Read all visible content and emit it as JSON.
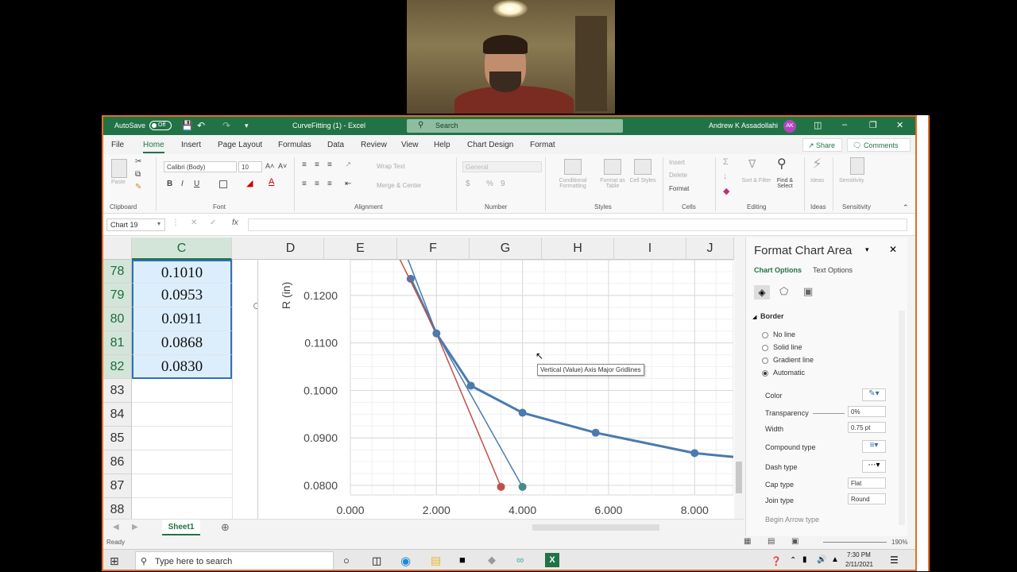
{
  "title_bar": {
    "autosave_label": "AutoSave",
    "autosave_state": "Off",
    "document_title": "CurveFitting (1) - Excel",
    "search_placeholder": "Search",
    "user_name": "Andrew K Assadollahi",
    "user_initials": "AK"
  },
  "ribbon_tabs": [
    "File",
    "Home",
    "Insert",
    "Page Layout",
    "Formulas",
    "Data",
    "Review",
    "View",
    "Help",
    "Chart Design",
    "Format"
  ],
  "ribbon_actions": {
    "share": "Share",
    "comments": "Comments"
  },
  "ribbon": {
    "clipboard": {
      "paste": "Paste",
      "label": "Clipboard"
    },
    "font": {
      "name": "Calibri (Body)",
      "size": "10",
      "label": "Font",
      "bold": "B",
      "italic": "I",
      "underline": "U"
    },
    "alignment": {
      "wrap": "Wrap Text",
      "merge": "Merge & Center",
      "label": "Alignment"
    },
    "number": {
      "format": "General",
      "label": "Number"
    },
    "styles": {
      "conditional": "Conditional Formatting",
      "format_table": "Format as Table",
      "cell_styles": "Cell Styles",
      "label": "Styles"
    },
    "cells": {
      "insert": "Insert",
      "delete": "Delete",
      "format": "Format",
      "label": "Cells"
    },
    "editing": {
      "sort": "Sort & Filter",
      "find": "Find & Select",
      "label": "Editing"
    },
    "ideas": {
      "ideas": "Ideas",
      "label": "Ideas"
    },
    "sensitivity": {
      "sensitivity": "Sensitivity",
      "label": "Sensitivity"
    }
  },
  "formula_bar": {
    "name_box": "Chart 19",
    "fx": "fx"
  },
  "columns": [
    "C",
    "D",
    "E",
    "F",
    "G",
    "H",
    "I",
    "J"
  ],
  "rows": [
    {
      "num": "78",
      "c": "0.1010"
    },
    {
      "num": "79",
      "c": "0.0953"
    },
    {
      "num": "80",
      "c": "0.0911"
    },
    {
      "num": "81",
      "c": "0.0868"
    },
    {
      "num": "82",
      "c": "0.0830"
    },
    {
      "num": "83",
      "c": ""
    },
    {
      "num": "84",
      "c": ""
    },
    {
      "num": "85",
      "c": ""
    },
    {
      "num": "86",
      "c": ""
    },
    {
      "num": "87",
      "c": ""
    },
    {
      "num": "88",
      "c": ""
    }
  ],
  "chart_data": {
    "type": "scatter",
    "title": "",
    "ylabel": "R (in)",
    "xlabel": "",
    "xlim": [
      0,
      8.9
    ],
    "ylim": [
      0.078,
      0.1275
    ],
    "x_ticks": [
      "0.000",
      "2.000",
      "4.000",
      "6.000",
      "8.000"
    ],
    "y_ticks": [
      "0.1200",
      "0.1100",
      "0.1000",
      "0.0900",
      "0.0800"
    ],
    "grid": true,
    "series": [
      {
        "color": "#4a7ab0",
        "marker": true,
        "x": [
          1.4,
          2.0,
          2.8,
          4.0,
          5.7,
          8.0,
          8.9
        ],
        "y": [
          0.1235,
          0.112,
          0.101,
          0.0953,
          0.0911,
          0.0868,
          0.086
        ]
      },
      {
        "color": "#c0504d",
        "marker": false,
        "x": [
          1.1,
          2.0,
          3.5
        ],
        "y": [
          0.1285,
          0.112,
          0.0797
        ]
      },
      {
        "color": "#4a7ab0",
        "marker": false,
        "x": [
          1.3,
          2.0,
          4.0
        ],
        "y": [
          0.1285,
          0.112,
          0.0797
        ]
      }
    ],
    "highlight_points": [
      {
        "x": 3.5,
        "y": 0.0797,
        "color": "#c0504d"
      },
      {
        "x": 4.0,
        "y": 0.0797,
        "color": "#4a8a8c"
      }
    ]
  },
  "tooltip": "Vertical (Value) Axis Major Gridlines",
  "sheet_tab": "Sheet1",
  "status": {
    "ready": "Ready",
    "zoom": "190%"
  },
  "format_pane": {
    "title": "Format Chart Area",
    "chart_options": "Chart Options",
    "text_options": "Text Options",
    "section": "Border",
    "border_options": [
      "No line",
      "Solid line",
      "Gradient line",
      "Automatic"
    ],
    "selected_option": "Automatic",
    "color_label": "Color",
    "transparency_label": "Transparency",
    "transparency_value": "0%",
    "width_label": "Width",
    "width_value": "0.75 pt",
    "compound_label": "Compound type",
    "dash_label": "Dash type",
    "cap_label": "Cap type",
    "cap_value": "Flat",
    "join_label": "Join type",
    "join_value": "Round",
    "begin_arrow_label": "Begin Arrow type"
  },
  "taskbar": {
    "search_placeholder": "Type here to search",
    "time": "7:30 PM",
    "date": "2/11/2021"
  },
  "colors": {
    "excel_green": "#217346",
    "selection": "#dceefc",
    "accent_orange": "#e46d1f"
  }
}
